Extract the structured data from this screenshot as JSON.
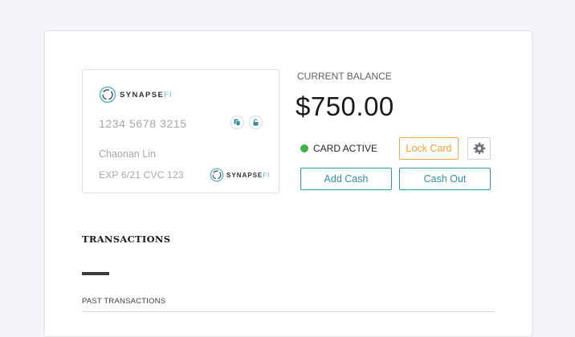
{
  "card": {
    "brand_main": "SYNAPSE",
    "brand_accent": "FI",
    "number": "1234 5678 3215",
    "holder": "Chaonan Lin",
    "exp_cvc": "EXP 6/21 CVC 123",
    "icons": [
      "copy-icon",
      "unlock-icon"
    ]
  },
  "account": {
    "balance_label": "CURRENT BALANCE",
    "balance": "$750.00",
    "status": "CARD ACTIVE",
    "status_color": "#3cb24a"
  },
  "actions": {
    "lock_label": "Lock Card",
    "settings_icon": "gear-icon",
    "add_cash_label": "Add Cash",
    "cash_out_label": "Cash Out"
  },
  "transactions": {
    "title": "TRANSACTIONS",
    "past_label": "PAST TRANSACTIONS"
  },
  "colors": {
    "accent_teal": "#2f9aa8",
    "lock_orange": "#f5a94a",
    "page_bg": "#f3f5f9"
  }
}
